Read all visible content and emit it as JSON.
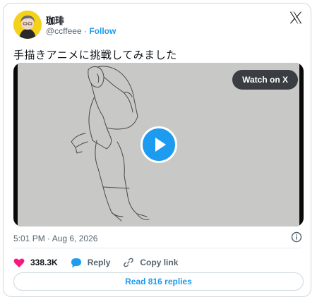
{
  "author": {
    "name": "珈琲",
    "handle": "@ccffeee",
    "separator": "·",
    "follow_label": "Follow"
  },
  "tweet": {
    "text": "手描きアニメに挑戦してみました",
    "timestamp": "5:01 PM · Aug 6, 2026"
  },
  "media": {
    "watch_label": "Watch on X"
  },
  "actions": {
    "like_count": "338.3K",
    "reply_label": "Reply",
    "copy_link_label": "Copy link"
  },
  "footer": {
    "read_replies_label": "Read 816 replies"
  },
  "colors": {
    "accent": "#1d9bf0",
    "like": "#f91880",
    "avatar_bg": "#f4d21c"
  },
  "icons": [
    "avatar",
    "x-logo-icon",
    "play-icon",
    "info-icon",
    "heart-icon",
    "reply-icon",
    "link-icon"
  ]
}
